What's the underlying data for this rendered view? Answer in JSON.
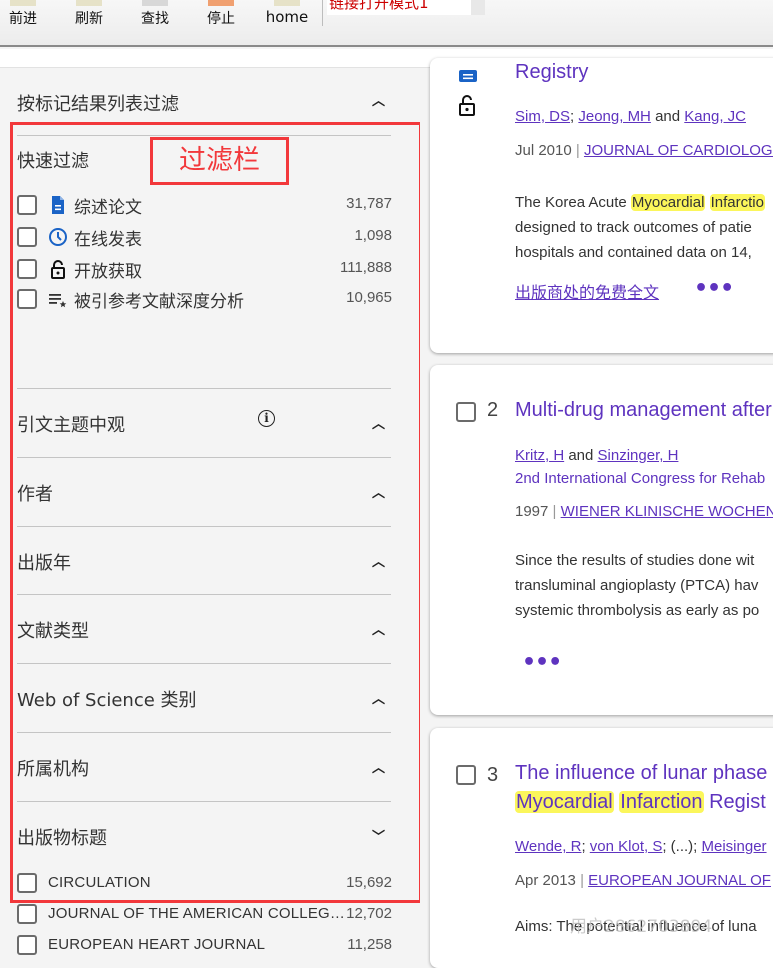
{
  "toolbar": {
    "buttons": [
      {
        "label": "前进",
        "icon": "forward-icon"
      },
      {
        "label": "刷新",
        "icon": "refresh-icon"
      },
      {
        "label": "查找",
        "icon": "find-icon"
      },
      {
        "label": "停止",
        "icon": "stop-icon"
      },
      {
        "label": "home",
        "icon": "home-icon"
      }
    ],
    "link_mode": "链接打开模式1"
  },
  "sidebar": {
    "marked_filter": "按标记结果列表过滤",
    "annotation_label": "过滤栏",
    "quick_filter": {
      "title": "快速过滤",
      "items": [
        {
          "label": "综述论文",
          "count": "31,787",
          "icon": "document-icon"
        },
        {
          "label": "在线发表",
          "count": "1,098",
          "icon": "clock-icon"
        },
        {
          "label": "开放获取",
          "count": "111,888",
          "icon": "unlock-icon"
        },
        {
          "label": "被引参考文献深度分析",
          "count": "10,965",
          "icon": "list-star-icon"
        }
      ]
    },
    "sections": [
      {
        "label": "引文主题中观",
        "expanded": true,
        "info": true
      },
      {
        "label": "作者",
        "expanded": true
      },
      {
        "label": "出版年",
        "expanded": true
      },
      {
        "label": "文献类型",
        "expanded": true
      },
      {
        "label": "Web of Science 类别",
        "expanded": true
      },
      {
        "label": "所属机构",
        "expanded": true
      },
      {
        "label": "出版物标题",
        "expanded": false
      }
    ],
    "publications": [
      {
        "label": "CIRCULATION",
        "count": "15,692"
      },
      {
        "label": "JOURNAL OF THE AMERICAN COLLEG…",
        "count": "12,702"
      },
      {
        "label": "EUROPEAN HEART JOURNAL",
        "count": "11,258"
      }
    ]
  },
  "results": [
    {
      "title_tail": "Registry",
      "authors": [
        "Sim, DS",
        "Jeong, MH",
        "Kang, JC"
      ],
      "author_seps": [
        ";",
        " and "
      ],
      "date": "Jul 2010",
      "journal": "JOURNAL OF CARDIOLOGY",
      "abstract_lines": [
        {
          "pre": "The Korea Acute ",
          "hl1": "Myocardial",
          "mid": " ",
          "hl2": "Infarctio",
          "post": ""
        },
        "designed to track outcomes of patie",
        "hospitals and contained data on 14,"
      ],
      "free_fulltext": "出版商处的免费全文",
      "more": "•••"
    },
    {
      "number": "2",
      "title": "Multi-drug management after",
      "authors": [
        "Kritz, H",
        "Sinzinger, H"
      ],
      "author_sep": " and ",
      "conference": "2nd International Congress for Rehab",
      "date": "1997",
      "journal": "WIENER KLINISCHE WOCHENSCHRIFT",
      "abstract_lines": [
        "Since the results of studies done wit",
        "transluminal angioplasty (PTCA) hav",
        "systemic thrombolysis as early as po"
      ],
      "more": "•••"
    },
    {
      "number": "3",
      "title_line1": "The influence of lunar phase",
      "title_hl1": "Myocardial",
      "title_hl2": "Infarction",
      "title_line2_tail": " Regist",
      "authors": [
        "Wende, R",
        "von Klot, S",
        "Meisinger"
      ],
      "ellipsis": "(...)",
      "date": "Apr 2013",
      "journal": "EUROPEAN JOURNAL OF",
      "abstract_start": "Aims: The potential influence of luna"
    }
  ],
  "watermark": "用户2862703894"
}
